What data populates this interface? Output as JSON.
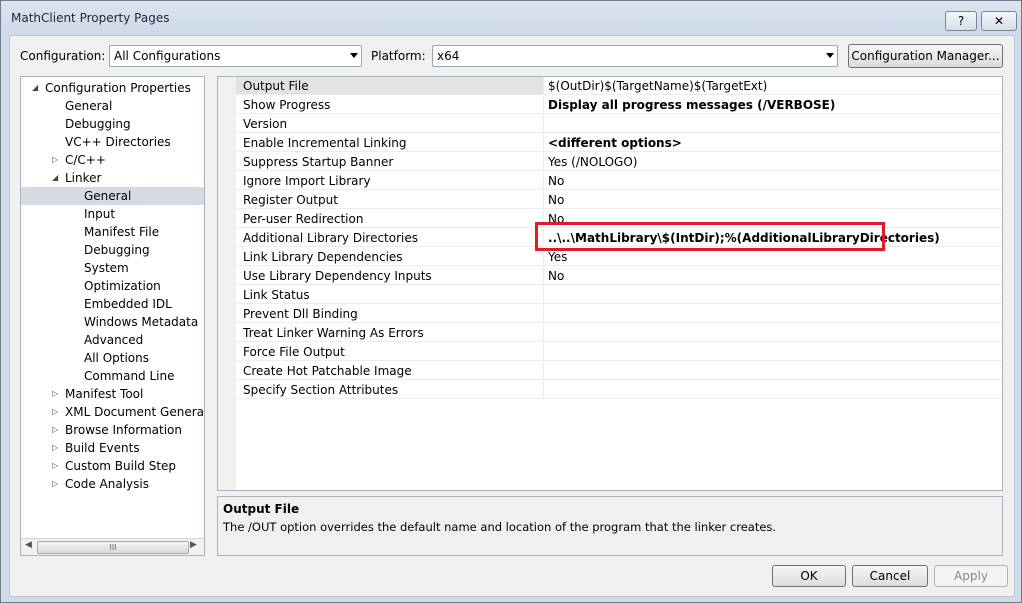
{
  "window": {
    "title": "MathClient Property Pages",
    "help_button": "?",
    "close_button": "✕"
  },
  "toolbar": {
    "configuration_label": "Configuration:",
    "configuration_value": "All Configurations",
    "platform_label": "Platform:",
    "platform_value": "x64",
    "config_manager_button": "Configuration Manager..."
  },
  "tree": [
    {
      "label": "Configuration Properties",
      "indent": 0,
      "expander": "◢"
    },
    {
      "label": "General",
      "indent": 1
    },
    {
      "label": "Debugging",
      "indent": 1
    },
    {
      "label": "VC++ Directories",
      "indent": 1
    },
    {
      "label": "C/C++",
      "indent": 1,
      "expander": "▷"
    },
    {
      "label": "Linker",
      "indent": 1,
      "expander": "◢"
    },
    {
      "label": "General",
      "indent": 2,
      "selected": true
    },
    {
      "label": "Input",
      "indent": 2
    },
    {
      "label": "Manifest File",
      "indent": 2
    },
    {
      "label": "Debugging",
      "indent": 2
    },
    {
      "label": "System",
      "indent": 2
    },
    {
      "label": "Optimization",
      "indent": 2
    },
    {
      "label": "Embedded IDL",
      "indent": 2
    },
    {
      "label": "Windows Metadata",
      "indent": 2
    },
    {
      "label": "Advanced",
      "indent": 2
    },
    {
      "label": "All Options",
      "indent": 2
    },
    {
      "label": "Command Line",
      "indent": 2
    },
    {
      "label": "Manifest Tool",
      "indent": 1,
      "expander": "▷"
    },
    {
      "label": "XML Document Generator",
      "indent": 1,
      "expander": "▷"
    },
    {
      "label": "Browse Information",
      "indent": 1,
      "expander": "▷"
    },
    {
      "label": "Build Events",
      "indent": 1,
      "expander": "▷"
    },
    {
      "label": "Custom Build Step",
      "indent": 1,
      "expander": "▷"
    },
    {
      "label": "Code Analysis",
      "indent": 1,
      "expander": "▷"
    }
  ],
  "properties": [
    {
      "name": "Output File",
      "value": "$(OutDir)$(TargetName)$(TargetExt)",
      "selected": true
    },
    {
      "name": "Show Progress",
      "value": "Display all progress messages (/VERBOSE)",
      "bold": true
    },
    {
      "name": "Version",
      "value": ""
    },
    {
      "name": "Enable Incremental Linking",
      "value": "<different options>",
      "bold": true
    },
    {
      "name": "Suppress Startup Banner",
      "value": "Yes (/NOLOGO)"
    },
    {
      "name": "Ignore Import Library",
      "value": "No"
    },
    {
      "name": "Register Output",
      "value": "No"
    },
    {
      "name": "Per-user Redirection",
      "value": "No"
    },
    {
      "name": "Additional Library Directories",
      "value": "..\\..\\MathLibrary\\$(IntDir);%(AdditionalLibraryDirectories)",
      "bold": true
    },
    {
      "name": "Link Library Dependencies",
      "value": "Yes"
    },
    {
      "name": "Use Library Dependency Inputs",
      "value": "No"
    },
    {
      "name": "Link Status",
      "value": ""
    },
    {
      "name": "Prevent Dll Binding",
      "value": ""
    },
    {
      "name": "Treat Linker Warning As Errors",
      "value": ""
    },
    {
      "name": "Force File Output",
      "value": ""
    },
    {
      "name": "Create Hot Patchable Image",
      "value": ""
    },
    {
      "name": "Specify Section Attributes",
      "value": ""
    }
  ],
  "description": {
    "title": "Output File",
    "text": "The /OUT option overrides the default name and location of the program that the linker creates."
  },
  "buttons": {
    "ok": "OK",
    "cancel": "Cancel",
    "apply": "Apply"
  },
  "scrollbar": {
    "thumb_grip": "III"
  },
  "colors": {
    "highlight_border": "#e01d24",
    "selection": "#d5dbe2"
  }
}
